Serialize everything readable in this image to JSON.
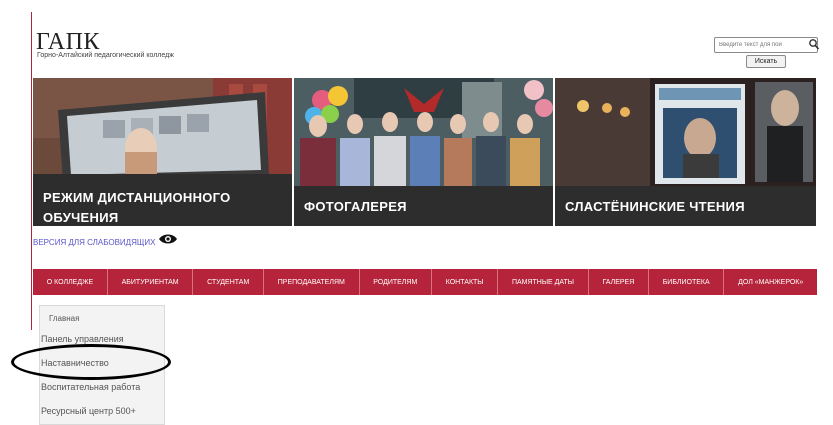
{
  "site": {
    "title": "ГАПК",
    "subtitle": "Горно-Алтайский педагогический колледж"
  },
  "search": {
    "placeholder": "Введите текст для пои",
    "button_label": "Искать"
  },
  "banners": [
    {
      "caption_line1": "РЕЖИМ ДИСТАНЦИОННОГО",
      "caption_line2": "ОБУЧЕНИЯ"
    },
    {
      "caption": "ФОТОГАЛЕРЕЯ"
    },
    {
      "caption": "СЛАСТЁНИНСКИЕ ЧТЕНИЯ"
    }
  ],
  "accessibility": {
    "label": "ВЕРСИЯ ДЛЯ СЛАБОВИДЯЩИХ"
  },
  "nav": {
    "items": [
      "О КОЛЛЕДЖЕ",
      "АБИТУРИЕНТАМ",
      "СТУДЕНТАМ",
      "ПРЕПОДАВАТЕЛЯМ",
      "РОДИТЕЛЯМ",
      "КОНТАКТЫ",
      "ПАМЯТНЫЕ ДАТЫ",
      "ГАЛЕРЕЯ",
      "БИБЛИОТЕКА",
      "ДОЛ «МАНЖЕРОК»"
    ]
  },
  "menu": {
    "top_label": "Главная",
    "items": [
      "Панель управления",
      "Наставничество",
      "Воспитательная работа",
      "Ресурсный центр 500+"
    ]
  },
  "colors": {
    "brand_red": "#b5243a",
    "caption_bg": "#2d2d2d",
    "link_purple": "#5a55c8"
  }
}
